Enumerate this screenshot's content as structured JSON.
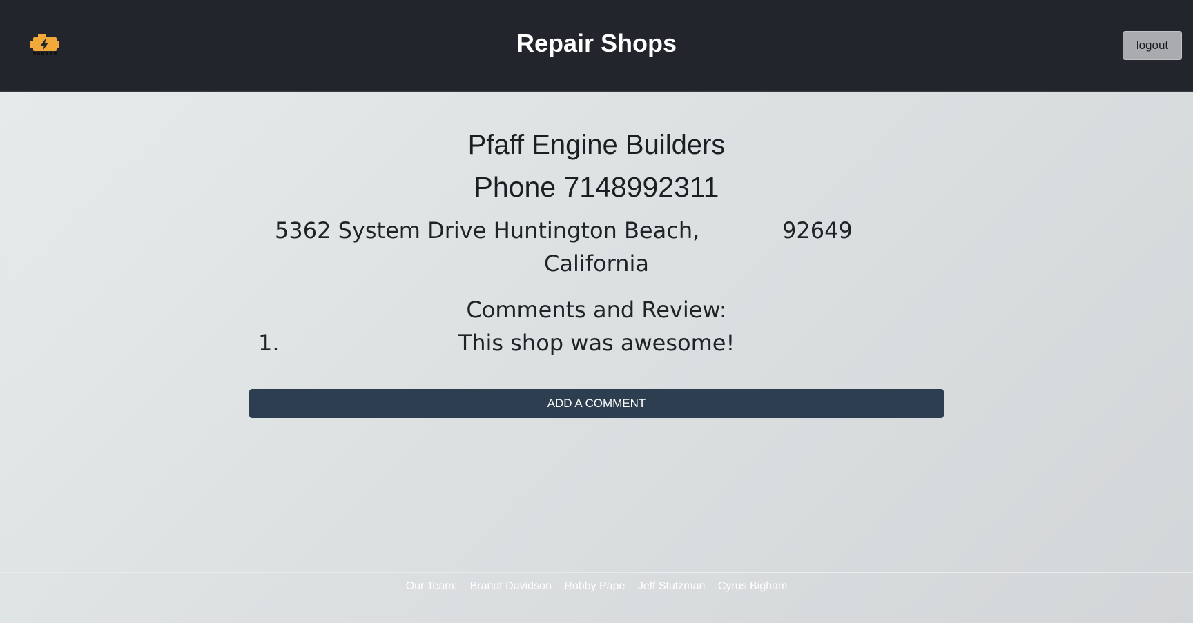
{
  "header": {
    "title": "Repair Shops",
    "logout_label": "logout",
    "logo_icon": "engine-icon",
    "logo_color": "#f2a93b"
  },
  "shop": {
    "name": "Pfaff Engine Builders",
    "phone": "Phone 7148992311",
    "street": "5362 System Drive",
    "city_state": "Huntington Beach, California",
    "zip": "92649"
  },
  "comments": {
    "title": "Comments and Review:",
    "items": [
      {
        "number": "1.",
        "text": "This shop was awesome!"
      }
    ]
  },
  "actions": {
    "add_comment_label": "ADD A COMMENT"
  },
  "footer": {
    "label": "Our Team:",
    "members": [
      "Brandt Davidson",
      "Robby Pape",
      "Jeff Stutzman",
      "Cyrus Bigham"
    ]
  }
}
